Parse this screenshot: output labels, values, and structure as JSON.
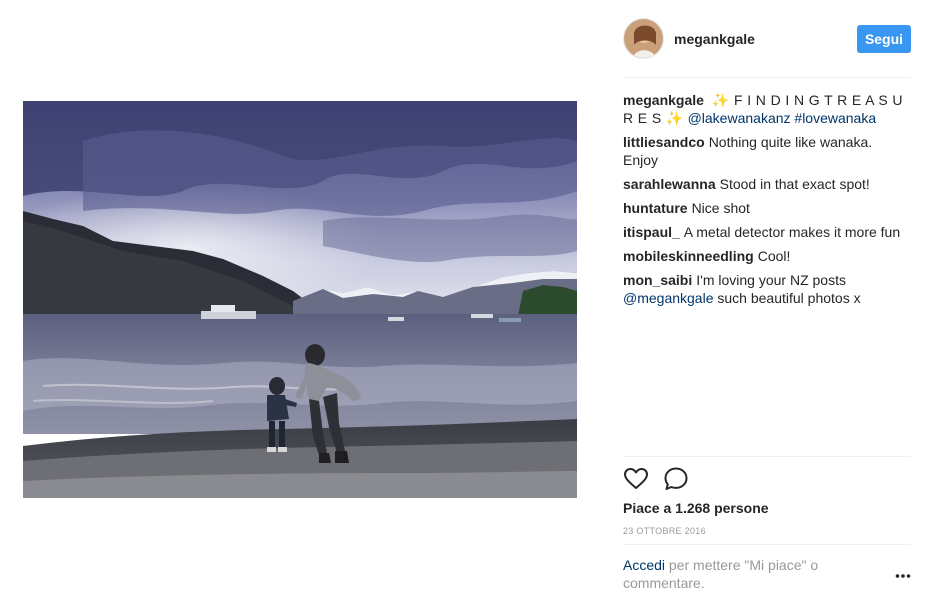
{
  "post": {
    "image_alt": "Woman and child on lakeshore with mountains and cloudy sky",
    "author": "megankgale",
    "follow_label": "Segui",
    "caption": {
      "user": "megankgale",
      "text": "✨ F I N D I N G T R E A S U R E S ✨",
      "mention": "@lakewanakanz",
      "hashtag": "#lovewanaka"
    },
    "comments": [
      {
        "user": "littliesandco",
        "text": "Nothing quite like wanaka. Enjoy"
      },
      {
        "user": "sarahlewanna",
        "text": "Stood in that exact spot!"
      },
      {
        "user": "huntature",
        "text": "Nice shot"
      },
      {
        "user": "itispaul_",
        "text": "A metal detector makes it more fun"
      },
      {
        "user": "mobileskinneedling",
        "text": "Cool!"
      },
      {
        "user": "mon_saibi",
        "text": "I'm loving your NZ posts",
        "mention": "@megankgale",
        "text2": "such beautiful photos x"
      }
    ],
    "likes_prefix": "Piace a",
    "likes_count": "1.268",
    "likes_suffix": "persone",
    "date": "23 ottobre 2016",
    "login": {
      "link": "Accedi",
      "text": "per mettere \"Mi piace\" o commentare."
    }
  },
  "icons": {
    "like": "heart-outline-icon",
    "comment": "speech-bubble-icon",
    "more": "ellipsis-icon"
  },
  "colors": {
    "accent": "#3897f0",
    "link": "#003569",
    "muted": "#999999",
    "divider": "#efefef"
  }
}
